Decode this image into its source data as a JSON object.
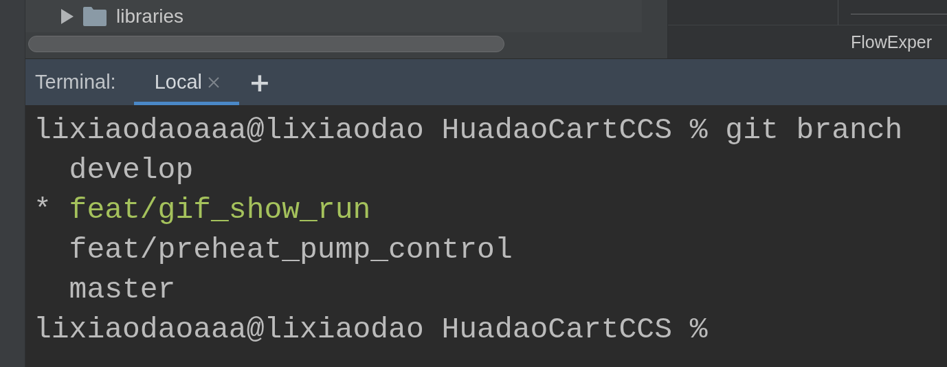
{
  "project_tree": {
    "items": [
      {
        "label": "libraries",
        "expanded": false
      }
    ]
  },
  "right_panel": {
    "label": "FlowExper"
  },
  "tool_window": {
    "title": "Terminal:",
    "tabs": [
      {
        "label": "Local",
        "selected": true
      }
    ],
    "add_button": "+"
  },
  "terminal": {
    "lines": [
      {
        "kind": "prompt",
        "text": "lixiaodaoaaa@lixiaodao HuadaoCartCCS % git branch"
      },
      {
        "kind": "branch",
        "name": "develop",
        "current": false
      },
      {
        "kind": "branch",
        "marker": "*",
        "name": "feat/gif_show_run",
        "current": true
      },
      {
        "kind": "branch",
        "name": "feat/preheat_pump_control",
        "current": false
      },
      {
        "kind": "branch",
        "name": "master",
        "current": false
      },
      {
        "kind": "prompt",
        "text": "lixiaodaoaaa@lixiaodao HuadaoCartCCS %"
      }
    ]
  }
}
